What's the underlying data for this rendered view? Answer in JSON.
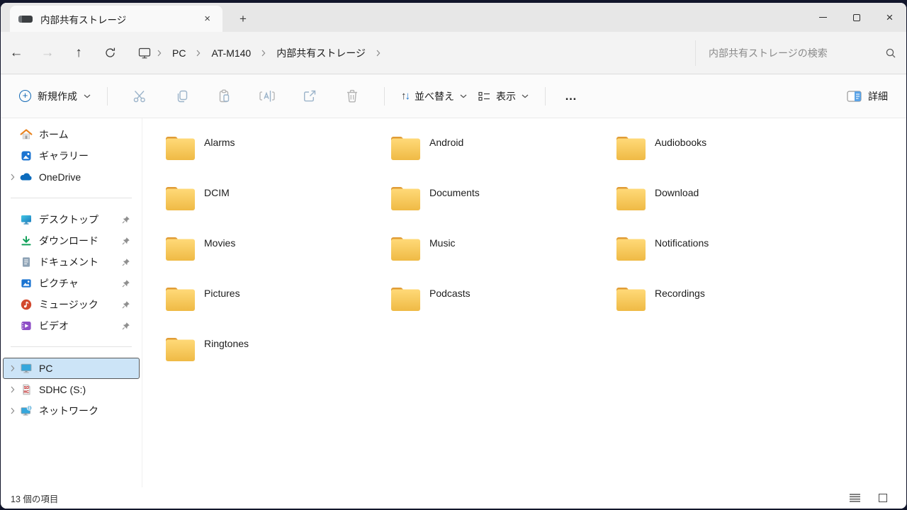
{
  "tab_bar": {
    "tab_title": "内部共有ストレージ"
  },
  "address_bar": {
    "breadcrumbs": [
      "PC",
      "AT-M140",
      "内部共有ストレージ"
    ],
    "search_placeholder": "内部共有ストレージの検索"
  },
  "toolbar": {
    "new_label": "新規作成",
    "sort_label": "並べ替え",
    "view_label": "表示",
    "more_label": "…",
    "details_label": "詳細"
  },
  "sidebar": {
    "items_top": [
      {
        "label": "ホーム",
        "icon": "home"
      },
      {
        "label": "ギャラリー",
        "icon": "gallery"
      },
      {
        "label": "OneDrive",
        "icon": "onedrive"
      }
    ],
    "items_pinned": [
      {
        "label": "デスクトップ",
        "icon": "desktop"
      },
      {
        "label": "ダウンロード",
        "icon": "download"
      },
      {
        "label": "ドキュメント",
        "icon": "document"
      },
      {
        "label": "ピクチャ",
        "icon": "pictures"
      },
      {
        "label": "ミュージック",
        "icon": "music"
      },
      {
        "label": "ビデオ",
        "icon": "video"
      }
    ],
    "items_tree": [
      {
        "label": "PC",
        "icon": "pc",
        "selected": true
      },
      {
        "label": "SDHC (S:)",
        "icon": "sd-card",
        "selected": false
      },
      {
        "label": "ネットワーク",
        "icon": "network",
        "selected": false
      }
    ]
  },
  "folders": [
    "Alarms",
    "Android",
    "Audiobooks",
    "DCIM",
    "Documents",
    "Download",
    "Movies",
    "Music",
    "Notifications",
    "Pictures",
    "Podcasts",
    "Recordings",
    "Ringtones"
  ],
  "status_bar": {
    "item_count": "13 個の項目"
  },
  "colors": {
    "accent": "#1369b5",
    "selection_bg": "#cce4f7",
    "folder_tab": "#e09c35",
    "folder_body_top": "#ffd978",
    "folder_body_bottom": "#efba45"
  }
}
